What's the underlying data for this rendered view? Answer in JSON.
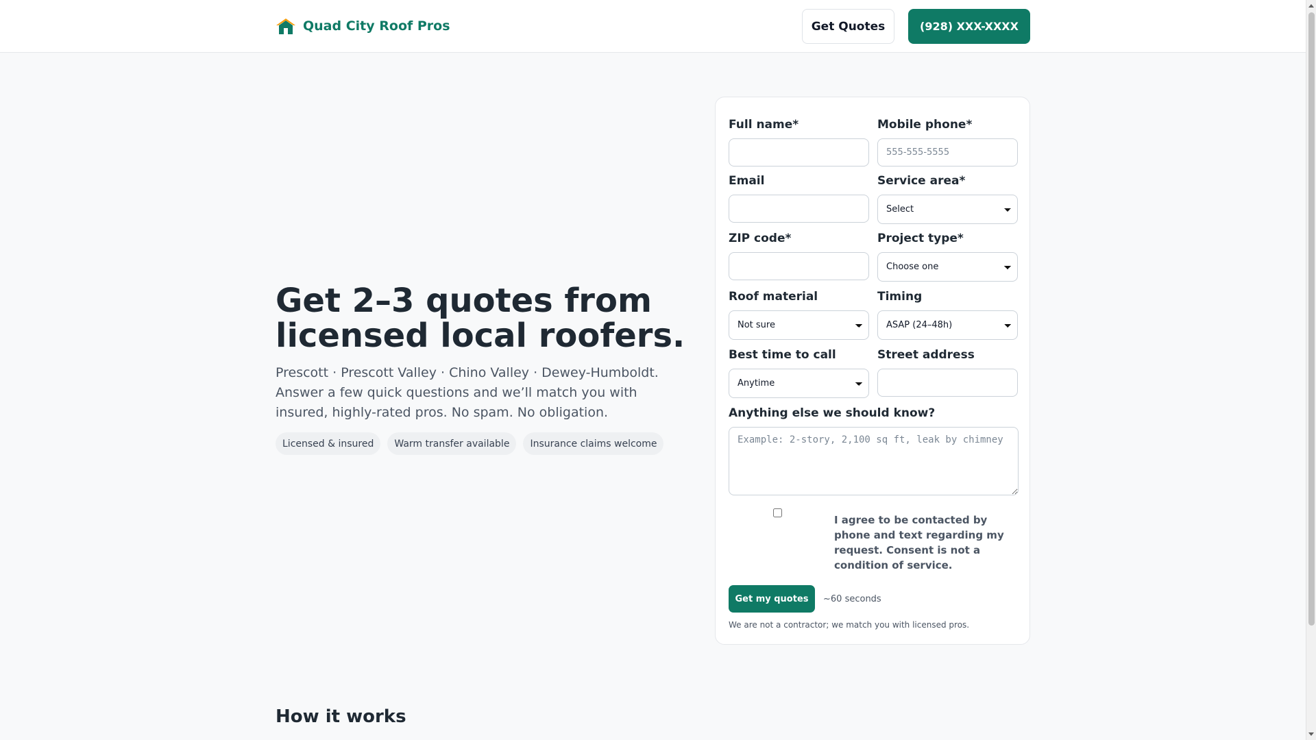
{
  "header": {
    "brand_name": "Quad City Roof Pros",
    "brand_icon": "house-icon",
    "get_quotes_label": "Get Quotes",
    "phone_label": "(928) XXX-XXXX",
    "accent_color": "#0f7a65"
  },
  "hero": {
    "title": "Get 2–3 quotes from licensed local roofers.",
    "subtitle": "Prescott · Prescott Valley · Chino Valley · Dewey-Humboldt. Answer a few quick questions and we’ll match you with insured, highly-rated pros. No spam. No obligation.",
    "badges": [
      "Licensed & insured",
      "Warm transfer available",
      "Insurance claims welcome"
    ]
  },
  "form": {
    "full_name": {
      "label": "Full name*",
      "value": ""
    },
    "mobile_phone": {
      "label": "Mobile phone*",
      "placeholder": "555-555-5555",
      "value": ""
    },
    "email": {
      "label": "Email",
      "value": ""
    },
    "service_area": {
      "label": "Service area*",
      "selected": "Select"
    },
    "zip_code": {
      "label": "ZIP code*",
      "value": ""
    },
    "project_type": {
      "label": "Project type*",
      "selected": "Choose one"
    },
    "roof_material": {
      "label": "Roof material",
      "selected": "Not sure"
    },
    "timing": {
      "label": "Timing",
      "selected": "ASAP (24–48h)"
    },
    "best_time": {
      "label": "Best time to call",
      "selected": "Anytime"
    },
    "street_address": {
      "label": "Street address",
      "value": ""
    },
    "notes": {
      "label": "Anything else we should know?",
      "placeholder": "Example: 2-story, 2,100 sq ft, leak by chimney"
    },
    "consent": {
      "checked": false,
      "text": "I agree to be contacted by phone and text regarding my request. Consent is not a condition of service."
    },
    "submit_label": "Get my quotes",
    "submit_note": "~60 seconds",
    "disclaimer": "We are not a contractor; we match you with licensed pros."
  },
  "how_it_works": {
    "title": "How it works"
  }
}
